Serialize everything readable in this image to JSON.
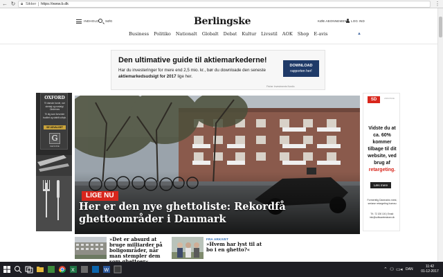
{
  "browser": {
    "secure_label": "Sikker",
    "url": "https://www.b.dk"
  },
  "header": {
    "menu_label": "INDHOLD",
    "search_label": "SØG",
    "logo": "Berlingske",
    "subscribe_label": "KØB ABONNEMENT",
    "login_label": "LOG IND"
  },
  "nav": {
    "items": [
      "Business",
      "Politiko",
      "Nationalt",
      "Globalt",
      "Debat",
      "Kultur",
      "Livsstil",
      "AOK",
      "Shop",
      "E-avis"
    ]
  },
  "ad_top": {
    "headline": "Den ultimative guide til aktiemarkederne!",
    "body_prefix": "Har du investeringer for mere end 2,5 mio. kr., bør du downloade den seneste",
    "body_bold": "aktiemarkedsudsigt for 2017",
    "body_suffix": "lige her.",
    "cta_line1": "DOWNLOAD",
    "cta_line2": "rapporten her!",
    "disclaimer": "Fisher Investments Nordic"
  },
  "ad_left": {
    "brand": "OXFORD",
    "text1": "Til danske borde, ovn stentøj og nostalgi. Ziedernes",
    "text2": "Til dig som forventer kvalitet og stabilt udtryk.",
    "order_label": "SE UDVALGET",
    "badge": "G",
    "badge_caption": "GENUINE"
  },
  "hero": {
    "badge": "LIGE NU",
    "title": "Her er den nye ghettoliste: Rekordfå ghettoområder i Danmark"
  },
  "ad_right": {
    "brand": "SD",
    "ad_label": "ANNONCE",
    "copy_prefix": "Vidste du at ca. 60% kommer tilbage til dit website, ved brug af",
    "copy_highlight": "retargeting.",
    "more_label": "Læs mere",
    "fine": "Formentlig Danmarks mest, seriøse retargeting bureau",
    "contact": "Tlf.: 72 200 100 | Email: info@softwaretesteam.dk"
  },
  "teasers": [
    {
      "kicker": "",
      "title": "»Det er absurd at bruge milliarder på boligområder, når man stempler dem som ghettoer«"
    },
    {
      "kicker": "FRA ARKIVET",
      "title": "»Hvem har lyst til at bo i en ghetto?«"
    }
  ],
  "taskbar": {
    "time": "11:42",
    "date": "01-12-2017",
    "lang": "DAN"
  },
  "colors": {
    "brand_red": "#d9261c",
    "cta_blue": "#1f3a68",
    "link_blue": "#2a6ab3"
  }
}
